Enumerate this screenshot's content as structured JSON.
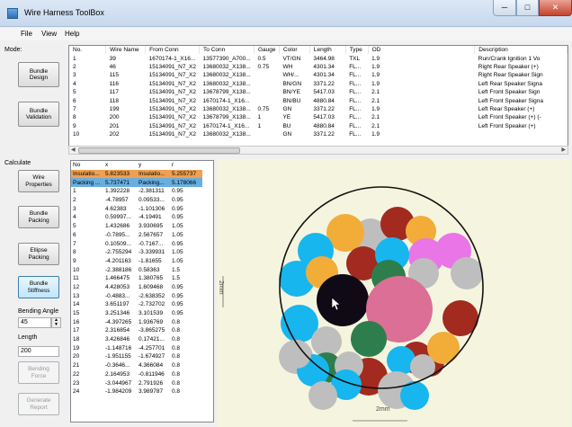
{
  "window": {
    "title": "Wire Harness ToolBox",
    "min_label": "─",
    "max_label": "□",
    "close_label": "✕"
  },
  "menu": [
    "File",
    "View",
    "Help"
  ],
  "left": {
    "mode_label": "Mode:",
    "bundle_design": "Bundle Design",
    "bundle_validation": "Bundle Validation",
    "calculate_label": "Calculate",
    "wire_properties": "Wire Properties",
    "bundle_packing": "Bundle Packing",
    "ellipse_packing": "Ellipse Packing",
    "bundle_stiffness": "Bundle Stiffness",
    "bending_angle_label": "Bending Angle",
    "bending_angle_value": "45",
    "length_label": "Length",
    "length_value": "200",
    "bending_force": "Bending Force",
    "generate_report": "Generate Report"
  },
  "wires_table": {
    "columns": [
      "No.",
      "Wire Name",
      "From Conn",
      "To Conn",
      "Gauge",
      "Color",
      "Length",
      "Type",
      "OD",
      "Description"
    ],
    "rows": [
      [
        "1",
        "39",
        "1670174-1_X16...",
        "13577390_A700...",
        "0.5",
        "VT/GN",
        "3464.98",
        "TXL",
        "1.9",
        "Run/Crank Ignition 1 Vo"
      ],
      [
        "2",
        "46",
        "15134091_N7_X2",
        "13680032_X138...",
        "0.75",
        "WH",
        "4301.34",
        "FL...",
        "1.9",
        "Right Rear Speaker (+)"
      ],
      [
        "3",
        "115",
        "15134091_N7_X2",
        "13680032_X138...",
        "",
        "WH/...",
        "4301.34",
        "FL...",
        "1.9",
        "Right Rear Speaker Sign"
      ],
      [
        "4",
        "116",
        "15134091_N7_X2",
        "13680032_X138...",
        "",
        "BN/GN",
        "3371.22",
        "FL...",
        "1.9",
        "Left Rear Speaker Signa"
      ],
      [
        "5",
        "117",
        "15134091_N7_X2",
        "13678799_X138...",
        "",
        "BN/YE",
        "5417.03",
        "FL...",
        "2.1",
        "Left Front Speaker Sign"
      ],
      [
        "6",
        "118",
        "15134091_N7_X2",
        "1670174-1_X16...",
        "",
        "BN/BU",
        "4880.84",
        "FL...",
        "2.1",
        "Left Front Speaker Signa"
      ],
      [
        "7",
        "199",
        "15134091_N7_X2",
        "13680032_X138...",
        "0.75",
        "GN",
        "3371.22",
        "FL...",
        "1.9",
        "Left Rear Speaker (+)"
      ],
      [
        "8",
        "200",
        "15134091_N7_X2",
        "13678799_X138...",
        "1",
        "YE",
        "5417.03",
        "FL...",
        "2.1",
        "Left Front Speaker (+) (-"
      ],
      [
        "9",
        "201",
        "15134091_N7_X2",
        "1670174-1_X16...",
        "1",
        "BU",
        "4880.84",
        "FL...",
        "2.1",
        "Left Front Speaker (+)"
      ],
      [
        "10",
        "202",
        "15134091_N7_X2",
        "13680032_X138...",
        "",
        "GN",
        "3371.22",
        "FL...",
        "1.9",
        ""
      ]
    ]
  },
  "packing_table": {
    "columns": [
      "No",
      "x",
      "y",
      "r"
    ],
    "rows": [
      [
        "Insulatio...",
        "5.823533",
        "Insulatio...",
        "5.255737"
      ],
      [
        "Packing ...",
        "5.737471",
        "Packing...",
        "5.178066"
      ],
      [
        "1",
        "1.392228",
        "-2.381311",
        "0.95"
      ],
      [
        "2",
        "-4.78957",
        "0.09533...",
        "0.95"
      ],
      [
        "3",
        "4.62383",
        "-1.101306",
        "0.95"
      ],
      [
        "4",
        "0.59997...",
        "-4.19491",
        "0.95"
      ],
      [
        "5",
        "1.432686",
        "3.930695",
        "1.05"
      ],
      [
        "6",
        "-0.7895...",
        "2.567657",
        "1.05"
      ],
      [
        "7",
        "0.10509...",
        "-0.7167...",
        "0.95"
      ],
      [
        "8",
        "-2.755294",
        "-3.339931",
        "1.05"
      ],
      [
        "9",
        "-4.201163",
        "-1.81655",
        "1.05"
      ],
      [
        "10",
        "-2.388186",
        "0.58363",
        "1.5"
      ],
      [
        "11",
        "1.466475",
        "1.380765",
        "1.5"
      ],
      [
        "12",
        "4.428053",
        "1.609468",
        "0.95"
      ],
      [
        "13",
        "-0.4883...",
        "-2.638352",
        "0.95"
      ],
      [
        "14",
        "3.651197",
        "-2.732702",
        "0.95"
      ],
      [
        "15",
        "3.251346",
        "3.101539",
        "0.95"
      ],
      [
        "16",
        "-4.397265",
        "1.936769",
        "0.8"
      ],
      [
        "17",
        "2.316854",
        "-3.865275",
        "0.8"
      ],
      [
        "18",
        "3.426846",
        "0.17421...",
        "0.8"
      ],
      [
        "19",
        "-1.148716",
        "-4.257701",
        "0.8"
      ],
      [
        "20",
        "-1.951155",
        "-1.674927",
        "0.8"
      ],
      [
        "21",
        "-0.3646...",
        "4.366084",
        "0.8"
      ],
      [
        "22",
        "2.164953",
        "-0.811946",
        "0.8"
      ],
      [
        "23",
        "-3.044967",
        "2.791926",
        "0.8"
      ],
      [
        "24",
        "-1.984209",
        "3.989787",
        "0.8"
      ]
    ]
  },
  "plot": {
    "dim_vertical": "2mm",
    "dim_horizontal": "2mm",
    "circle_colors": {
      "black": "#0f0a15",
      "pink": "#db6f95",
      "red": "#a22a1f",
      "green": "#2d7e4c",
      "orange": "#f2ad39",
      "cyan": "#17b6ef",
      "magenta": "#ea75e6",
      "gray": "#bebebe"
    }
  }
}
